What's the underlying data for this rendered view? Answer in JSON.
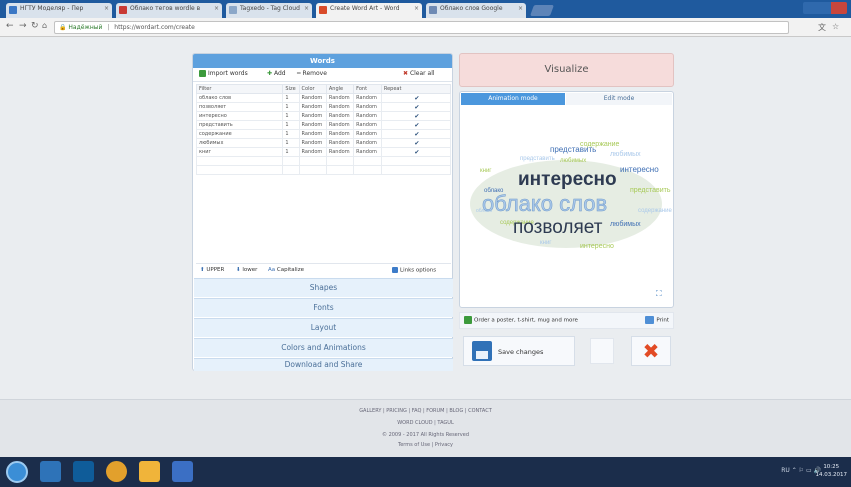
{
  "browser": {
    "tabs": [
      {
        "label": "НГТУ Моделяр - Пер",
        "fav": "#3a77c5",
        "active": false
      },
      {
        "label": "Облако тегов wordle в",
        "fav": "#c93a35",
        "active": false
      },
      {
        "label": "Tagxedo - Tag Cloud",
        "fav": "#8ba7c8",
        "active": false
      },
      {
        "label": "Create Word Art - Word",
        "fav": "#d94b2a",
        "active": true
      },
      {
        "label": "Облако слов Google",
        "fav": "#6e8ab4",
        "active": false
      }
    ],
    "address": {
      "secure_label": "Надёжный",
      "url": "https://wordart.com/create"
    }
  },
  "words_panel": {
    "title": "Words",
    "toolbar": {
      "import": "Import words",
      "add": "Add",
      "remove": "Remove",
      "clear": "Clear all"
    },
    "columns": [
      "Filter",
      "Size",
      "Color",
      "Angle",
      "Font",
      "Repeat"
    ],
    "rows": [
      {
        "word": "облако слов",
        "size": "1",
        "color": "Random",
        "angle": "Random",
        "font": "Random",
        "repeat": "✔"
      },
      {
        "word": "позволяет",
        "size": "1",
        "color": "Random",
        "angle": "Random",
        "font": "Random",
        "repeat": "✔"
      },
      {
        "word": "интересно",
        "size": "1",
        "color": "Random",
        "angle": "Random",
        "font": "Random",
        "repeat": "✔"
      },
      {
        "word": "представить",
        "size": "1",
        "color": "Random",
        "angle": "Random",
        "font": "Random",
        "repeat": "✔"
      },
      {
        "word": "содержание",
        "size": "1",
        "color": "Random",
        "angle": "Random",
        "font": "Random",
        "repeat": "✔"
      },
      {
        "word": "любимых",
        "size": "1",
        "color": "Random",
        "angle": "Random",
        "font": "Random",
        "repeat": "✔"
      },
      {
        "word": "книг",
        "size": "1",
        "color": "Random",
        "angle": "Random",
        "font": "Random",
        "repeat": "✔"
      }
    ],
    "bottom": {
      "upper": "UPPER",
      "lower": "lower",
      "capitalize": "Capitalize",
      "options": "Links options"
    }
  },
  "sections": [
    "Shapes",
    "Fonts",
    "Layout",
    "Colors and Animations",
    "Download and Share"
  ],
  "visualize": {
    "title": "Visualize",
    "tab_animation": "Animation mode",
    "tab_edit": "Edit mode",
    "cloud": {
      "big1": "интересно",
      "big2": "облако слов",
      "big3": "позволяет",
      "small": [
        "представить",
        "содержание",
        "любимых",
        "книг",
        "интересно",
        "облако"
      ],
      "colors": {
        "dark": "#2e3b52",
        "mid": "#3f6fb4",
        "green": "#a7c957",
        "light": "#a9c8ea",
        "shadow": "#c7d6c2"
      }
    },
    "order": "Order a poster, t-shirt, mug and more",
    "print": "Print",
    "save": "Save changes"
  },
  "footer": {
    "links": "GALLERY  |  PRICING  |  FAQ  |  FORUM  |  BLOG  |  CONTACT",
    "line2": "WORD CLOUD  |  TAGUL",
    "copyright": "© 2009 - 2017 All Rights Reserved",
    "terms": "Terms of Use  |  Privacy"
  },
  "taskbar": {
    "tray": "RU  ⌃  ⚐  ▭  🔊",
    "time": "10:25",
    "date": "14.03.2017"
  }
}
